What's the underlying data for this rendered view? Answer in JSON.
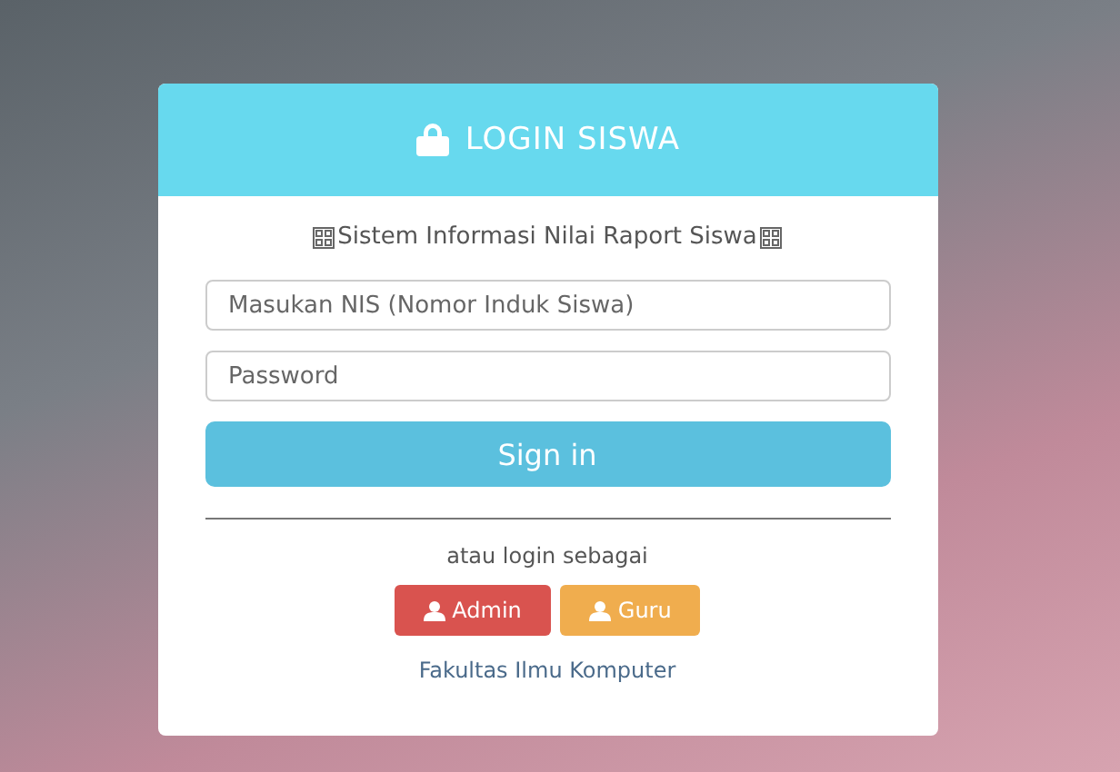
{
  "header": {
    "title": "LOGIN SISWA"
  },
  "subtitle": "Sistem Informasi Nilai Raport Siswa",
  "fields": [
    {
      "placeholder": "Masukan NIS (Nomor Induk Siswa)"
    },
    {
      "placeholder": "Password"
    }
  ],
  "submit": "Sign in",
  "alt_label": "atau login sebagai",
  "role_buttons": [
    {
      "label": "Admin",
      "color": "#d9534f"
    },
    {
      "label": "Guru",
      "color": "#f0ad4e"
    }
  ],
  "footer": "Fakultas Ilmu Komputer"
}
